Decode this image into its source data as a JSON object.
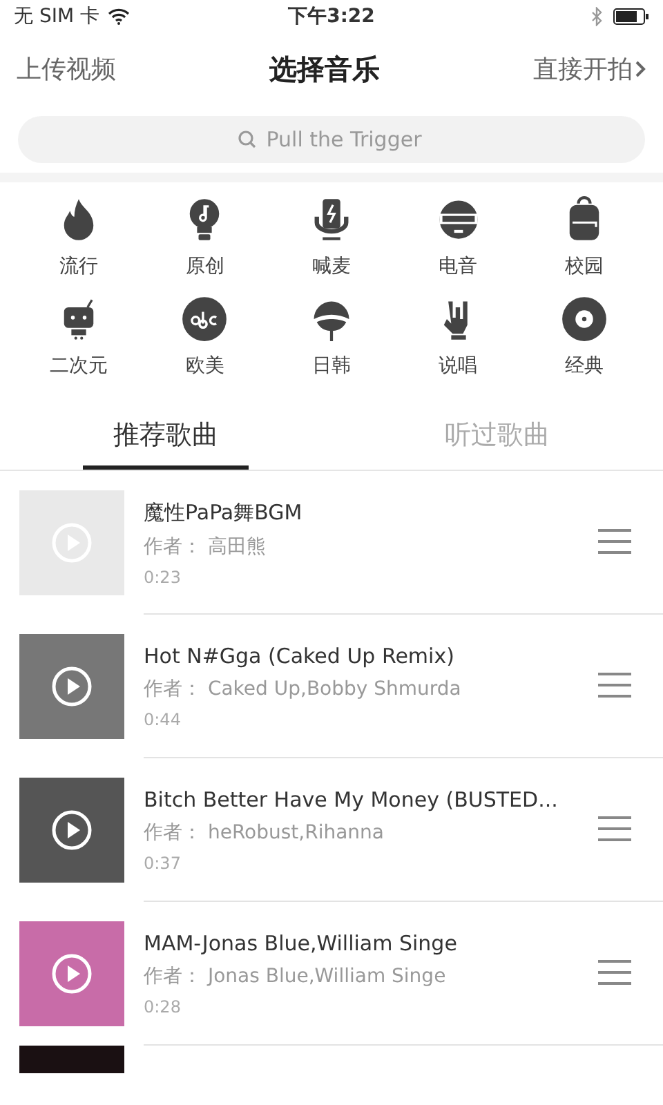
{
  "status_bar": {
    "carrier": "无 SIM 卡",
    "time": "下午3:22"
  },
  "nav": {
    "left": "上传视频",
    "title": "选择音乐",
    "right": "直接开拍"
  },
  "search": {
    "placeholder": "Pull the Trigger"
  },
  "categories": [
    {
      "label": "流行"
    },
    {
      "label": "原创"
    },
    {
      "label": "喊麦"
    },
    {
      "label": "电音"
    },
    {
      "label": "校园"
    },
    {
      "label": "二次元"
    },
    {
      "label": "欧美"
    },
    {
      "label": "日韩"
    },
    {
      "label": "说唱"
    },
    {
      "label": "经典"
    }
  ],
  "tabs": [
    {
      "label": "推荐歌曲",
      "selected": true
    },
    {
      "label": "听过歌曲",
      "selected": false
    }
  ],
  "songs": [
    {
      "title": "魔性PaPa舞BGM",
      "author_label": "作者：",
      "author": "高田熊",
      "duration": "0:23"
    },
    {
      "title": "Hot N#Gga (Caked Up Remix)",
      "author_label": "作者：",
      "author": "Caked Up,Bobby Shmurda",
      "duration": "0:44"
    },
    {
      "title": "Bitch Better Have My Money (BUSTED...",
      "author_label": "作者：",
      "author": "heRobust,Rihanna",
      "duration": "0:37"
    },
    {
      "title": "MAM-Jonas Blue,William Singe",
      "author_label": "作者：",
      "author": "Jonas Blue,William Singe",
      "duration": "0:28"
    }
  ]
}
